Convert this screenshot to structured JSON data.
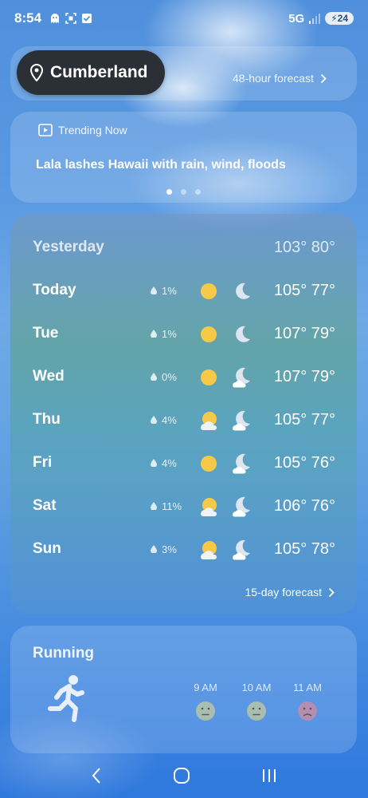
{
  "status_bar": {
    "time": "8:54",
    "network": "5G",
    "battery": "24"
  },
  "location": {
    "name": "Cumberland"
  },
  "hourly_link": {
    "label": "48-hour forecast"
  },
  "trending": {
    "header": "Trending Now",
    "headline": "Lala lashes Hawaii with rain, wind, floods",
    "page_count": 3,
    "active_page": 1
  },
  "daily": {
    "yesterday": {
      "label": "Yesterday",
      "temps": "103° 80°"
    },
    "days": [
      {
        "label": "Today",
        "precip": "1%",
        "day_icon": "sunny-icon",
        "night_icon": "moon-icon",
        "temps": "105° 77°"
      },
      {
        "label": "Tue",
        "precip": "1%",
        "day_icon": "sunny-icon",
        "night_icon": "moon-icon",
        "temps": "107° 79°"
      },
      {
        "label": "Wed",
        "precip": "0%",
        "day_icon": "sunny-icon",
        "night_icon": "moon-cloud-icon",
        "temps": "107° 79°"
      },
      {
        "label": "Thu",
        "precip": "4%",
        "day_icon": "partly-sunny-icon",
        "night_icon": "moon-cloud-icon",
        "temps": "105° 77°"
      },
      {
        "label": "Fri",
        "precip": "4%",
        "day_icon": "sunny-icon",
        "night_icon": "moon-cloud-icon",
        "temps": "105° 76°"
      },
      {
        "label": "Sat",
        "precip": "11%",
        "day_icon": "partly-sunny-icon",
        "night_icon": "moon-cloud-icon",
        "temps": "106° 76°"
      },
      {
        "label": "Sun",
        "precip": "3%",
        "day_icon": "partly-sunny-icon",
        "night_icon": "moon-cloud-icon",
        "temps": "105° 78°"
      }
    ],
    "more_link": "15-day forecast"
  },
  "running": {
    "title": "Running",
    "hours": [
      {
        "time": "9 AM",
        "rating_icon": "neutral-face-icon"
      },
      {
        "time": "10 AM",
        "rating_icon": "neutral-face-icon"
      },
      {
        "time": "11 AM",
        "rating_icon": "sad-face-icon"
      }
    ]
  },
  "colors": {
    "sun": "#f7c948",
    "pill": "#2b2f36",
    "sad_face": "#d98a9b",
    "neutral_face": "#c9cf9a"
  }
}
